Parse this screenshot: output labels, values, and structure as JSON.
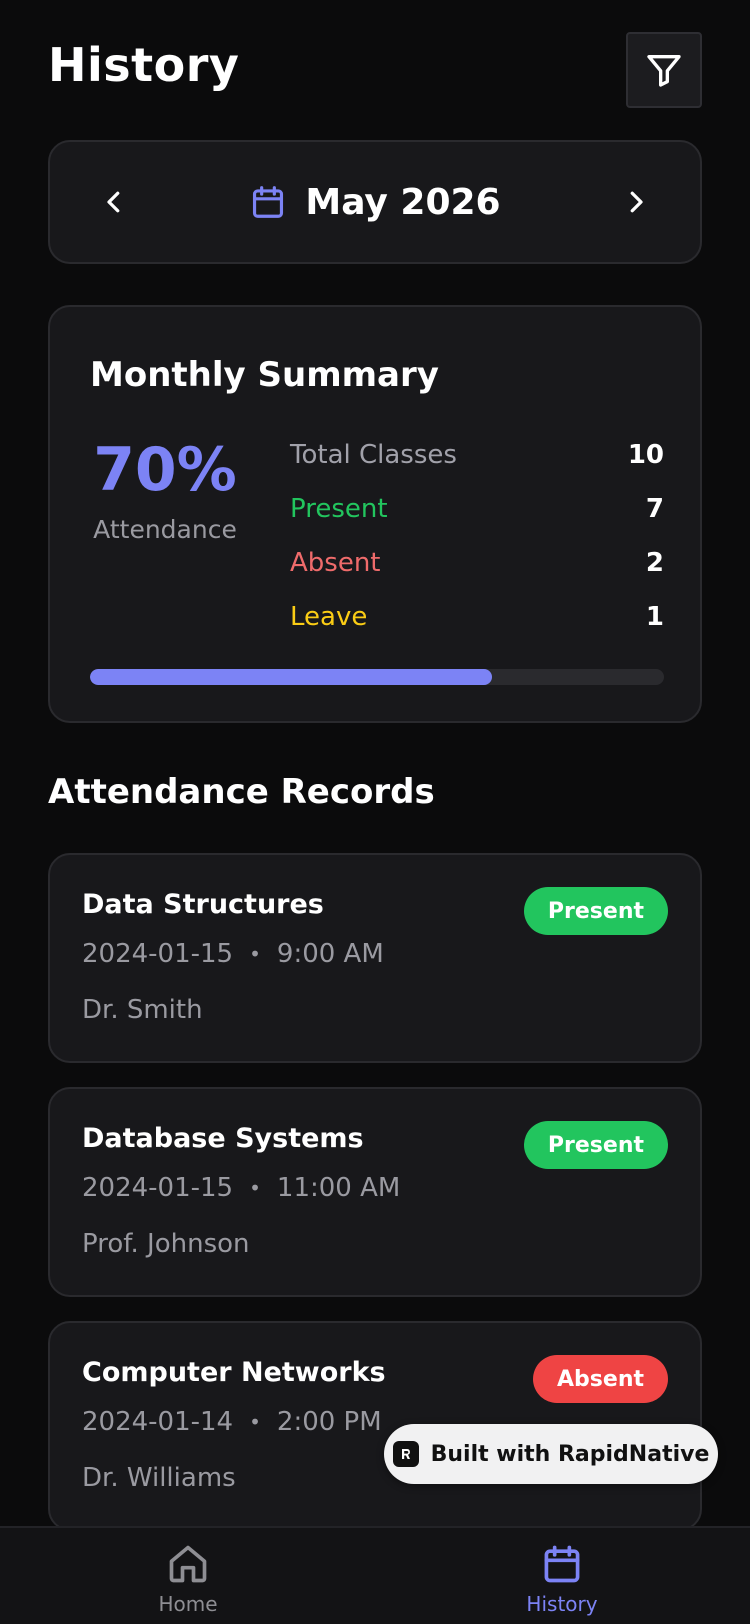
{
  "header": {
    "title": "History"
  },
  "month": {
    "label": "May 2026"
  },
  "summary": {
    "title": "Monthly Summary",
    "percent": "70%",
    "percent_label": "Attendance",
    "progress_fraction": 0.7,
    "rows": [
      {
        "label": "Total Classes",
        "value": "10",
        "color": "#a1a1aa"
      },
      {
        "label": "Present",
        "value": "7",
        "color": "#22c55e"
      },
      {
        "label": "Absent",
        "value": "2",
        "color": "#ef6b6b"
      },
      {
        "label": "Leave",
        "value": "1",
        "color": "#facc15"
      }
    ]
  },
  "records_section": {
    "title": "Attendance Records"
  },
  "records": [
    {
      "subject": "Data Structures",
      "date": "2024-01-15",
      "time": "9:00 AM",
      "teacher": "Dr. Smith",
      "status": "Present",
      "status_color": "#22c55e"
    },
    {
      "subject": "Database Systems",
      "date": "2024-01-15",
      "time": "11:00 AM",
      "teacher": "Prof. Johnson",
      "status": "Present",
      "status_color": "#22c55e"
    },
    {
      "subject": "Computer Networks",
      "date": "2024-01-14",
      "time": "2:00 PM",
      "teacher": "Dr. Williams",
      "status": "Absent",
      "status_color": "#ef4444"
    }
  ],
  "separator": "•",
  "watermark": {
    "label": "Built with RapidNative"
  },
  "nav": {
    "home": {
      "label": "Home",
      "icon": "home-icon",
      "color": "#8e8e93"
    },
    "history": {
      "label": "History",
      "icon": "calendar-icon",
      "color": "#7c83f5"
    }
  },
  "colors": {
    "accent": "#7c83f5",
    "background": "#0b0b0c",
    "card": "#18181b"
  }
}
